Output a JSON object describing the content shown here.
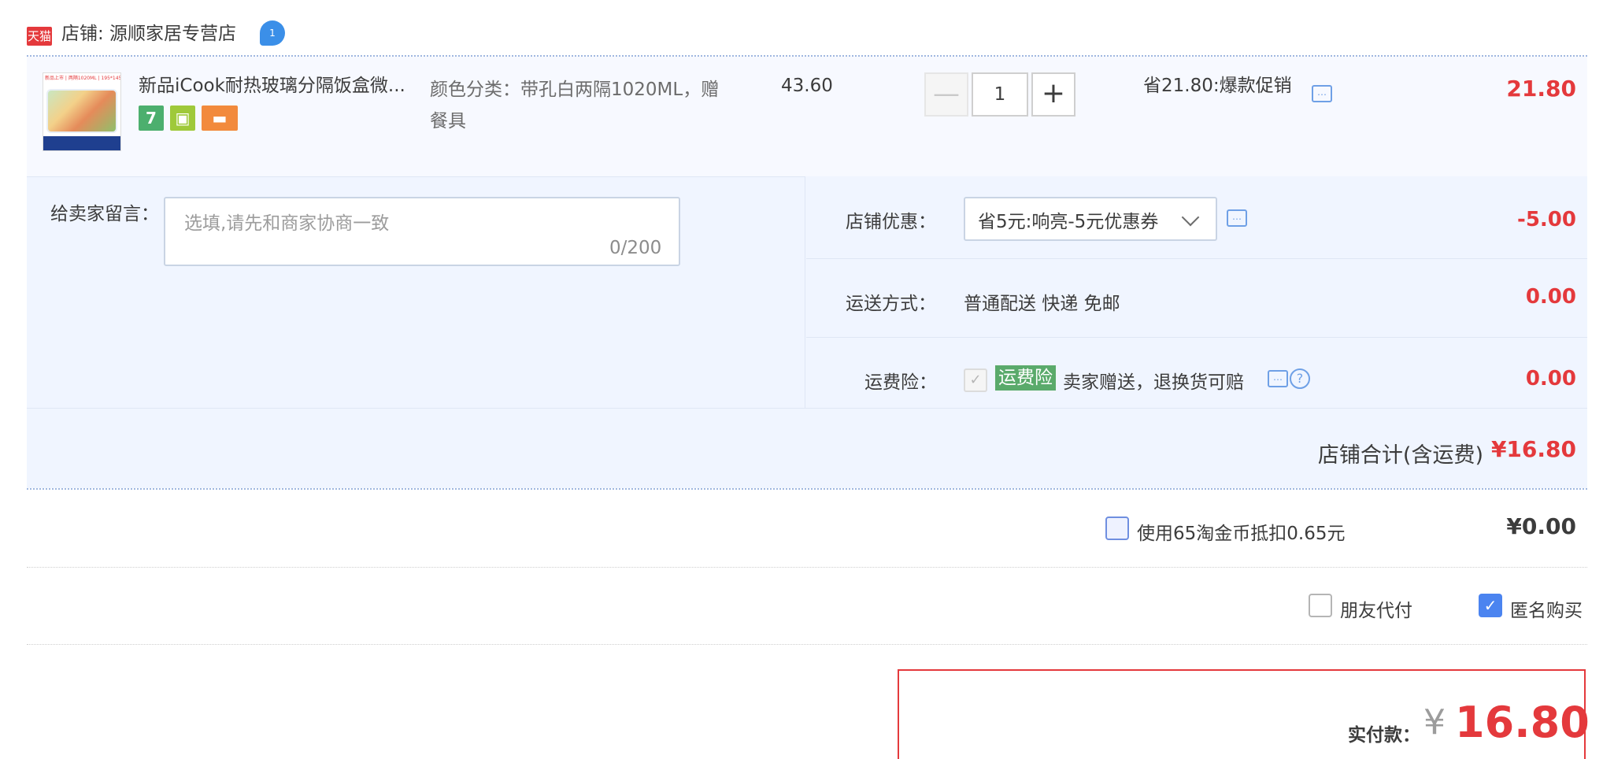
{
  "shop": {
    "badge": "天猫",
    "name": "店铺: 源顺家居专营店",
    "chat_badge": "1"
  },
  "item": {
    "thumb_caption": "新品上市 | 两隔1020ML | 195*145*62mm",
    "title": "新品iCook耐热玻璃分隔饭盒微...",
    "service_icons": [
      "seven-day-return-icon",
      "bag-icon",
      "card-icon"
    ],
    "service_7": "7",
    "sku": "颜色分类：带孔白两隔1020ML，赠餐具",
    "unit_price": "43.60",
    "quantity": "1",
    "minus": "—",
    "plus": "+",
    "promo": "省21.80:爆款促销",
    "subtotal": "21.80"
  },
  "message": {
    "label": "给卖家留言：",
    "placeholder": "选填,请先和商家协商一致",
    "count": "0/200"
  },
  "shop_discount": {
    "label": "店铺优惠：",
    "selected": "省5元:响亮-5元优惠券",
    "amount": "-5.00"
  },
  "shipping": {
    "label": "运送方式：",
    "value": "普通配送 快递 免邮",
    "amount": "0.00"
  },
  "insurance": {
    "label": "运费险：",
    "tag": "运费险",
    "text": "卖家赠送，退换货可赔",
    "amount": "0.00",
    "help": "?"
  },
  "shop_total": {
    "label": "店铺合计(含运费)",
    "amount": "¥16.80"
  },
  "coins": {
    "label": "使用65淘金币抵扣0.65元",
    "amount": "¥0.00"
  },
  "options": {
    "friend_pay": "朋友代付",
    "anonymous": "匿名购买",
    "anonymous_checked": true
  },
  "pay": {
    "label": "实付款：",
    "currency": "¥",
    "amount": "16.80"
  },
  "colors": {
    "accent_red": "#e4393c",
    "link_blue": "#6fa0e6",
    "panel_bg": "#f0f5ff",
    "check_blue": "#4b84f0",
    "insurance_green": "#5aaa6b"
  }
}
